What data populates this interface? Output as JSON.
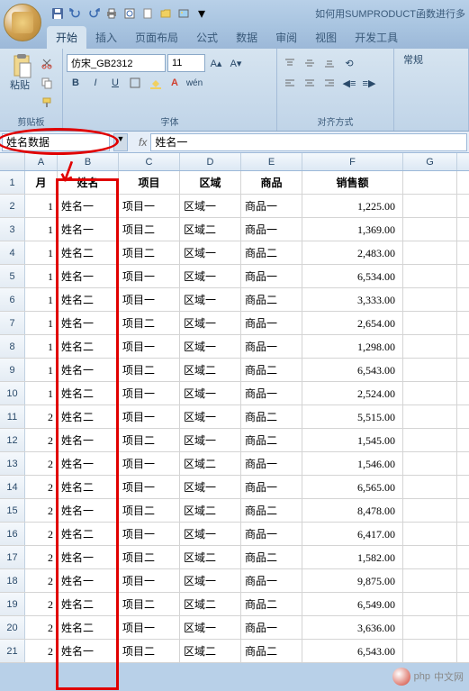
{
  "titlebar": {
    "title": "如何用SUMPRODUCT函数进行多"
  },
  "tabs": {
    "start": "开始",
    "insert": "插入",
    "layout": "页面布局",
    "formula": "公式",
    "data": "数据",
    "review": "审阅",
    "view": "视图",
    "dev": "开发工具"
  },
  "ribbon": {
    "clipboard": {
      "label": "剪贴板",
      "paste": "粘贴"
    },
    "font": {
      "label": "字体",
      "name": "仿宋_GB2312",
      "size": "11",
      "bold": "B",
      "italic": "I",
      "underline": "U"
    },
    "align": {
      "label": "对齐方式"
    },
    "general": {
      "label": "常规"
    }
  },
  "namebar": {
    "name": "姓名数据",
    "fx": "fx",
    "formula": "姓名一"
  },
  "headers": {
    "A": "A",
    "B": "B",
    "C": "C",
    "D": "D",
    "E": "E",
    "F": "F",
    "G": "G"
  },
  "chart_data": {
    "type": "table",
    "columns": [
      "月",
      "姓名",
      "项目",
      "区域",
      "商品",
      "销售额"
    ],
    "rows": [
      [
        1,
        "姓名一",
        "项目一",
        "区域一",
        "商品一",
        "1,225.00"
      ],
      [
        1,
        "姓名一",
        "项目二",
        "区域二",
        "商品一",
        "1,369.00"
      ],
      [
        1,
        "姓名二",
        "项目二",
        "区域一",
        "商品二",
        "2,483.00"
      ],
      [
        1,
        "姓名一",
        "项目一",
        "区域一",
        "商品一",
        "6,534.00"
      ],
      [
        1,
        "姓名二",
        "项目一",
        "区域一",
        "商品二",
        "3,333.00"
      ],
      [
        1,
        "姓名一",
        "项目二",
        "区域一",
        "商品一",
        "2,654.00"
      ],
      [
        1,
        "姓名二",
        "项目一",
        "区域一",
        "商品一",
        "1,298.00"
      ],
      [
        1,
        "姓名一",
        "项目二",
        "区域二",
        "商品二",
        "6,543.00"
      ],
      [
        1,
        "姓名二",
        "项目一",
        "区域一",
        "商品一",
        "2,524.00"
      ],
      [
        2,
        "姓名二",
        "项目一",
        "区域一",
        "商品二",
        "5,515.00"
      ],
      [
        2,
        "姓名一",
        "项目二",
        "区域一",
        "商品二",
        "1,545.00"
      ],
      [
        2,
        "姓名一",
        "项目一",
        "区域二",
        "商品一",
        "1,546.00"
      ],
      [
        2,
        "姓名二",
        "项目一",
        "区域一",
        "商品一",
        "6,565.00"
      ],
      [
        2,
        "姓名一",
        "项目二",
        "区域二",
        "商品二",
        "8,478.00"
      ],
      [
        2,
        "姓名二",
        "项目一",
        "区域一",
        "商品一",
        "6,417.00"
      ],
      [
        2,
        "姓名一",
        "项目二",
        "区域二",
        "商品二",
        "1,582.00"
      ],
      [
        2,
        "姓名一",
        "项目一",
        "区域一",
        "商品一",
        "9,875.00"
      ],
      [
        2,
        "姓名二",
        "项目二",
        "区域二",
        "商品二",
        "6,549.00"
      ],
      [
        2,
        "姓名二",
        "项目一",
        "区域一",
        "商品一",
        "3,636.00"
      ],
      [
        2,
        "姓名一",
        "项目二",
        "区域二",
        "商品二",
        "6,543.00"
      ]
    ]
  },
  "watermark": {
    "text": "中文网",
    "brand": "php"
  }
}
